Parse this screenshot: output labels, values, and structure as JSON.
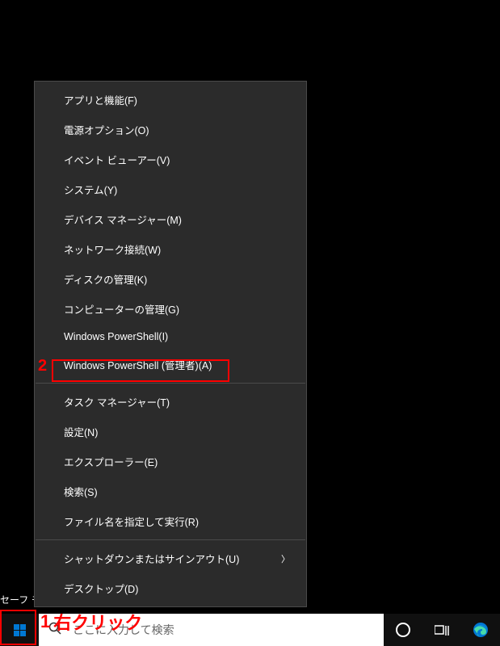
{
  "safe_mode_label": "セーフ モ",
  "context_menu": {
    "groups": [
      [
        {
          "label": "アプリと機能(F)",
          "id": "apps-features"
        },
        {
          "label": "電源オプション(O)",
          "id": "power-options"
        },
        {
          "label": "イベント ビューアー(V)",
          "id": "event-viewer"
        },
        {
          "label": "システム(Y)",
          "id": "system"
        },
        {
          "label": "デバイス マネージャー(M)",
          "id": "device-manager"
        },
        {
          "label": "ネットワーク接続(W)",
          "id": "network-connections"
        },
        {
          "label": "ディスクの管理(K)",
          "id": "disk-management"
        },
        {
          "label": "コンピューターの管理(G)",
          "id": "computer-management"
        },
        {
          "label": "Windows PowerShell(I)",
          "id": "powershell"
        },
        {
          "label": "Windows PowerShell (管理者)(A)",
          "id": "powershell-admin"
        }
      ],
      [
        {
          "label": "タスク マネージャー(T)",
          "id": "task-manager"
        },
        {
          "label": "設定(N)",
          "id": "settings"
        },
        {
          "label": "エクスプローラー(E)",
          "id": "explorer"
        },
        {
          "label": "検索(S)",
          "id": "search"
        },
        {
          "label": "ファイル名を指定して実行(R)",
          "id": "run"
        }
      ],
      [
        {
          "label": "シャットダウンまたはサインアウト(U)",
          "id": "shutdown-signout",
          "submenu": true
        },
        {
          "label": "デスクトップ(D)",
          "id": "desktop"
        }
      ]
    ]
  },
  "annotations": {
    "num1": "1",
    "num1_text": "右クリック",
    "num2": "2"
  },
  "taskbar": {
    "search_placeholder": "ここに入力して検索"
  }
}
